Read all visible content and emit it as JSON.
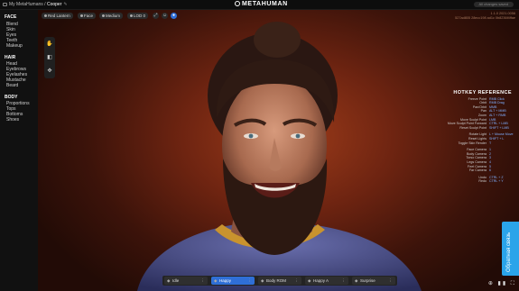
{
  "topbar": {
    "breadcrumb_root": "My MetaHumans /",
    "breadcrumb_current": "Cooper",
    "edit_glyph": "✎",
    "brand": "METAHUMAN",
    "status_pill": "All changes saved"
  },
  "sidebar": {
    "face_title": "FACE",
    "face_items": [
      "Blend",
      "Skin",
      "Eyes",
      "Teeth",
      "Makeup"
    ],
    "hair_title": "HAIR",
    "hair_items": [
      "Head",
      "Eyebrows",
      "Eyelashes",
      "Mustache",
      "Beard"
    ],
    "body_title": "BODY",
    "body_items": [
      "Proportions",
      "Tops",
      "Bottoms",
      "Shoes"
    ]
  },
  "viewport_toolbar": {
    "buttons": [
      "Red Lantern",
      "Face",
      "Medium",
      "LOD 0"
    ],
    "icons": [
      "⤢",
      "☺",
      "●"
    ],
    "version_line1": "1.1.0 2021.0056",
    "version_line2": "527ad805 28ecc198 ad1c 0b8236f4ffae"
  },
  "side_tools": {
    "icons": [
      "✋",
      "◧",
      "✥"
    ]
  },
  "hotkeys": {
    "title": "HOTKEY REFERENCE",
    "rows": [
      {
        "name": "Freeze Point",
        "key": "RMB Click"
      },
      {
        "name": "Orbit",
        "key": "RMB Drag"
      },
      {
        "name": "Pan/Orbit",
        "key": "MMB"
      },
      {
        "name": "Pan",
        "key": "ALT + MMB"
      },
      {
        "name": "Zoom",
        "key": "ALT + RMB"
      },
      {
        "name": "Move Sculpt Point",
        "key": "LMB"
      },
      {
        "name": "Move Sculpt Point Forward",
        "key": "CTRL + LMB"
      },
      {
        "name": "Reset Sculpt Point",
        "key": "SHIFT + LMB"
      },
      {
        "name": "",
        "key": ""
      },
      {
        "name": "Rotate Light",
        "key": "L + Mouse Move"
      },
      {
        "name": "Reset Lights",
        "key": "SHIFT + L"
      },
      {
        "name": "Toggle Skin Render",
        "key": "T"
      },
      {
        "name": "",
        "key": ""
      },
      {
        "name": "Face Camera",
        "key": "1"
      },
      {
        "name": "Body Camera",
        "key": "2"
      },
      {
        "name": "Torso Camera",
        "key": "3"
      },
      {
        "name": "Legs Camera",
        "key": "4"
      },
      {
        "name": "Feet Camera",
        "key": "5"
      },
      {
        "name": "Far Camera",
        "key": "6"
      },
      {
        "name": "",
        "key": ""
      },
      {
        "name": "Undo",
        "key": "CTRL + Z"
      },
      {
        "name": "Redo",
        "key": "CTRL + Y"
      }
    ]
  },
  "feedback": {
    "label": "Обратная связь"
  },
  "bottom_right_icons": "⊕ ▮▮ ⛶",
  "anim_bar": {
    "slots": [
      {
        "icon": "◆",
        "label": "Idle",
        "menu": "⋮",
        "active": false
      },
      {
        "icon": "◆",
        "label": "Happy",
        "menu": "⋮",
        "active": true
      },
      {
        "icon": "◆",
        "label": "Body ROM",
        "menu": "⋮",
        "active": false
      },
      {
        "icon": "◆",
        "label": "Happy A",
        "menu": "⋮",
        "active": false
      },
      {
        "icon": "◆",
        "label": "Surprise",
        "menu": "⋮",
        "active": false
      }
    ]
  },
  "colors": {
    "accent": "#2f6fd6",
    "feedback": "#2aa4ea",
    "background_glow": "#9e3c1a"
  }
}
